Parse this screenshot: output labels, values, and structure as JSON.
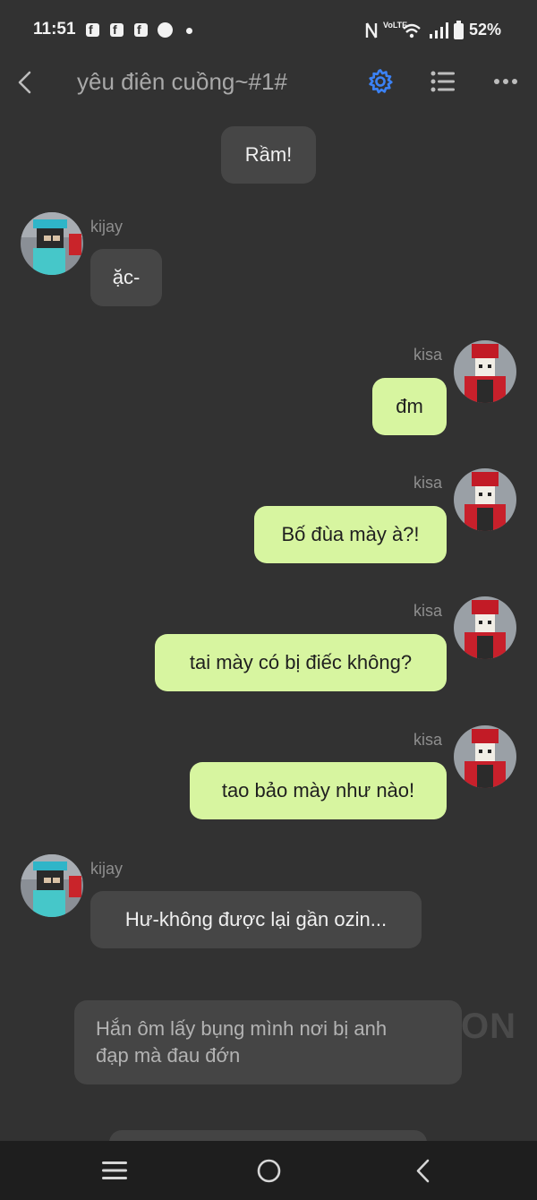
{
  "status_bar": {
    "time": "11:51",
    "fb_letter": "f",
    "network": "VoLTE",
    "battery": "52%"
  },
  "header": {
    "title": "yêu điên cuồng~#1#"
  },
  "messages": {
    "m0": {
      "text": "Rầm!"
    },
    "m1": {
      "sender": "kijay",
      "text": "ặc-"
    },
    "m2": {
      "sender": "kisa",
      "text": "đm"
    },
    "m3": {
      "sender": "kisa",
      "text": "Bố đùa mày à?!"
    },
    "m4": {
      "sender": "kisa",
      "text": "tai mày có bị điếc không?"
    },
    "m5": {
      "sender": "kisa",
      "text": "tao bảo mày như nào!"
    },
    "m6": {
      "sender": "kijay",
      "text": "Hư-không được lại gần ozin..."
    },
    "m7": {
      "text_line1": "Hắn ôm lấy bụng mình nơi bị anh",
      "text_line2": "đạp mà đau đớn"
    }
  },
  "watermark": "ON",
  "colors": {
    "background": "#323232",
    "bubble_gray": "#464646",
    "bubble_green": "#d7f5a0",
    "accent_blue": "#3b82f6"
  }
}
